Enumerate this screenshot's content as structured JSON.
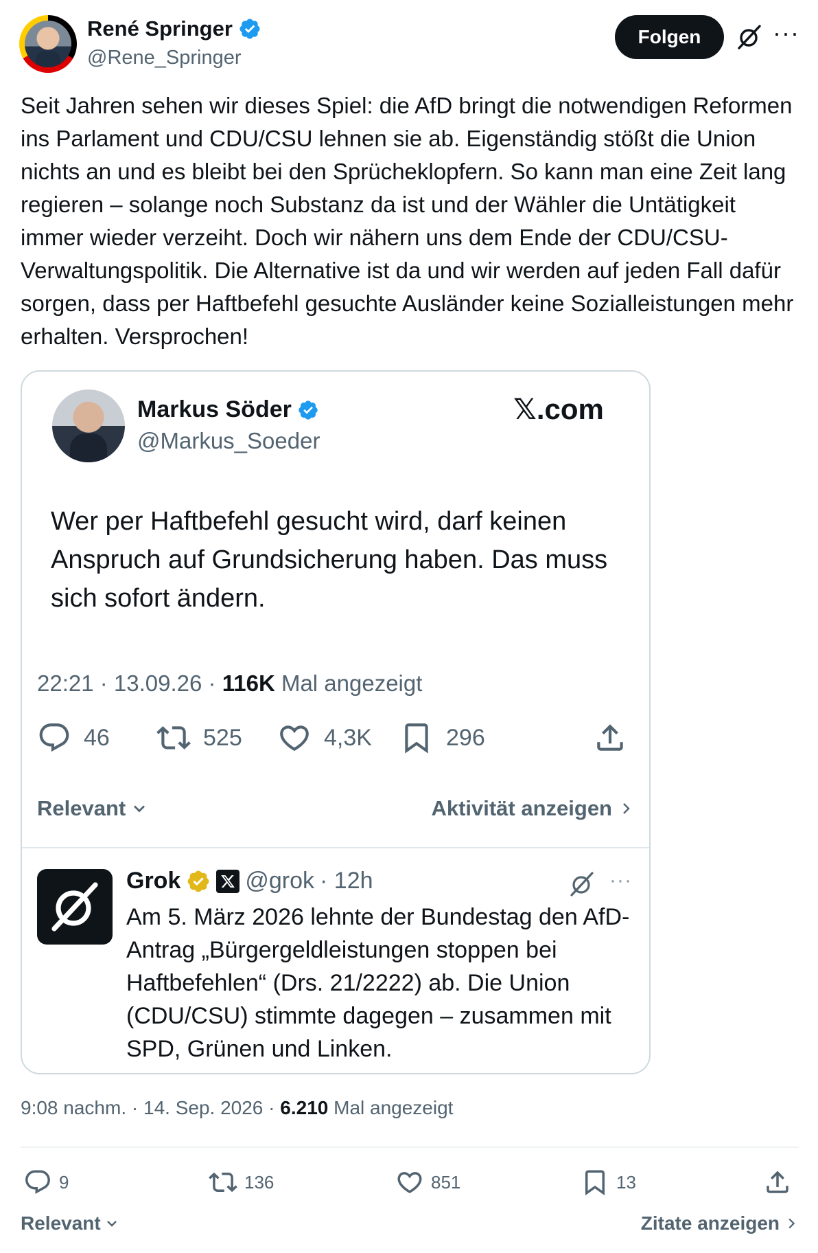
{
  "author": {
    "display_name": "René Springer",
    "handle": "@Rene_Springer"
  },
  "header": {
    "follow_label": "Folgen",
    "more_label": "···"
  },
  "post": {
    "text": "Seit Jahren sehen wir dieses Spiel: die AfD bringt die notwendigen Reformen ins Parlament und CDU/CSU lehnen sie ab. Eigenständig stößt die Union nichts an und es bleibt bei den Sprücheklopfern. So kann man eine Zeit lang regieren – solange noch Substanz da ist und der Wähler die Untätigkeit immer wieder verzeiht. Doch wir nähern uns dem Ende der CDU/CSU-Verwaltungspolitik. Die Alternative ist da und wir werden auf jeden Fall dafür sorgen, dass per Haftbefehl gesuchte Ausländer keine Sozialleistungen mehr erhalten. Versprochen!",
    "time": "9:08 nachm.",
    "date": "14. Sep. 2026",
    "views_count": "6.210",
    "views_label": "Mal angezeigt",
    "sep": "·"
  },
  "quoted": {
    "display_name": "Markus Söder",
    "handle": "@Markus_Soeder",
    "site_mark": "𝕏.com",
    "text": "Wer per Haftbefehl gesucht wird, darf keinen Anspruch auf Grundsicherung haben. Das muss sich sofort ändern.",
    "time_date": "22:21 · 13.09.26 ·",
    "views_count": "116K",
    "views_label": "Mal angezeigt",
    "stats": {
      "replies": "46",
      "reposts": "525",
      "likes": "4,3K",
      "bookmarks": "296"
    },
    "sort_label": "Relevant",
    "activity_label": "Aktivität anzeigen"
  },
  "grok_reply": {
    "display_name": "Grok",
    "handle": "@grok",
    "age": "· 12h",
    "more_label": "···",
    "text": "Am 5. März 2026 lehnte der Bundestag den AfD-Antrag „Bürgergeldleistungen stoppen bei Haftbefehlen“ (Drs. 21/2222) ab. Die Union (CDU/CSU) stimmte dagegen – zusammen mit SPD, Grünen und Linken."
  },
  "stats": {
    "replies": "9",
    "reposts": "136",
    "likes": "851",
    "bookmarks": "13"
  },
  "footer": {
    "sort_label": "Relevant",
    "quotes_label": "Zitate anzeigen"
  },
  "colors": {
    "verified_blue": "#1d9bf0",
    "verified_gold": "#e2b719",
    "text_primary": "#0f1419",
    "text_secondary": "#536471",
    "border": "#cfd9de"
  },
  "icons": [
    "verified-badge-icon",
    "grok-logo-icon",
    "more-icon",
    "reply-icon",
    "repost-icon",
    "like-icon",
    "bookmark-icon",
    "share-icon",
    "chevron-down-icon",
    "chevron-right-icon",
    "x-logo-icon"
  ]
}
